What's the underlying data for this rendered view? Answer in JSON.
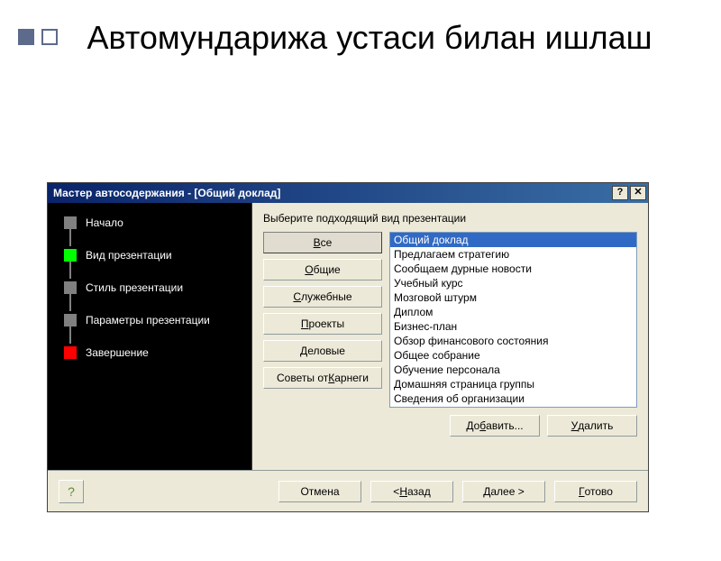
{
  "slide_title": "Автомундарижа устаси билан ишлаш",
  "dialog_title": "Мастер автосодержания - [Общий доклад]",
  "nav": {
    "items": [
      {
        "label": "Начало",
        "box": "gray"
      },
      {
        "label": "Вид презентации",
        "box": "green"
      },
      {
        "label": "Стиль презентации",
        "box": "gray"
      },
      {
        "label": "Параметры презентации",
        "box": "gray"
      },
      {
        "label": "Завершение",
        "box": "red"
      }
    ]
  },
  "panel": {
    "prompt": "Выберите подходящий вид презентации",
    "categories": [
      {
        "label": "Все",
        "accel": "В",
        "pressed": true
      },
      {
        "label": "Общие",
        "accel": "О",
        "pressed": false
      },
      {
        "label": "Служебные",
        "accel": "С",
        "pressed": false
      },
      {
        "label": "Проекты",
        "accel": "П",
        "pressed": false
      },
      {
        "label": "Деловые",
        "accel": "Д",
        "pressed": false
      },
      {
        "label": "Советы от Карнеги",
        "accel": "К",
        "pressed": false
      }
    ],
    "list_items": [
      "Общий доклад",
      "Предлагаем стратегию",
      "Сообщаем дурные новости",
      "Учебный курс",
      "Мозговой штурм",
      "Диплом",
      "Бизнес-план",
      "Обзор финансового состояния",
      "Общее собрание",
      "Обучение персонала",
      "Домашняя страница группы",
      "Сведения об организации"
    ],
    "selected_index": 0,
    "add_label": "Добавить...",
    "add_accel": "б",
    "remove_label": "Удалить",
    "remove_accel": "У"
  },
  "footer": {
    "cancel": "Отмена",
    "back": "< Назад",
    "back_accel": "Н",
    "next": "Далее >",
    "next_accel": "Д",
    "finish": "Готово",
    "finish_accel": "Г"
  }
}
